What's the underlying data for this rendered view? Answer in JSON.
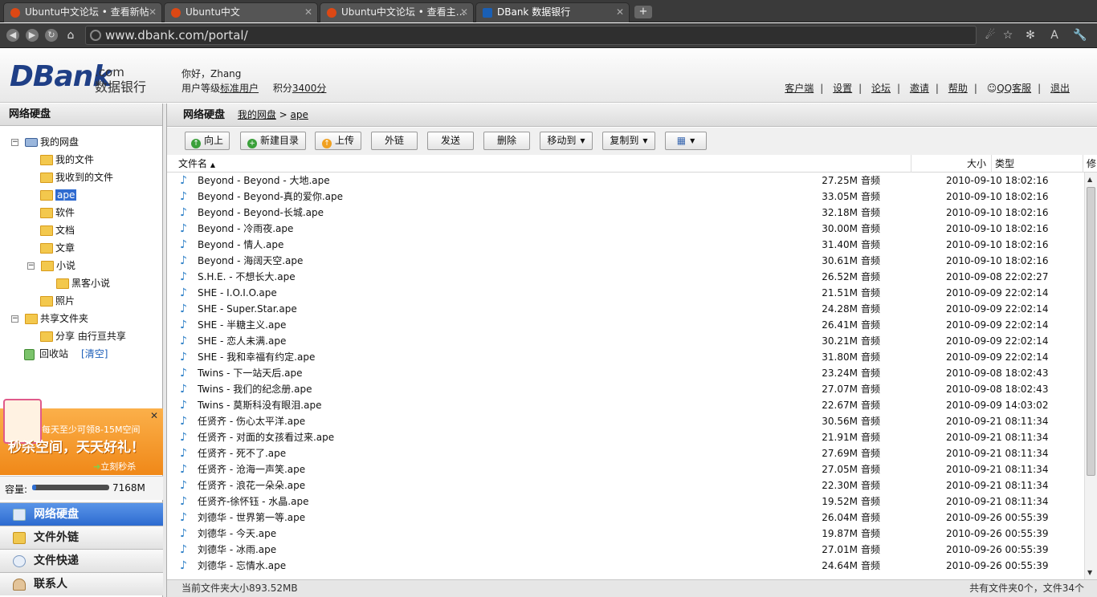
{
  "browser": {
    "tabs": [
      {
        "title": "Ubuntu中文论坛 • 查看新帖",
        "active": false
      },
      {
        "title": "Ubuntu中文",
        "active": false
      },
      {
        "title": "Ubuntu中文论坛 • 查看主…",
        "active": false
      },
      {
        "title": "DBank 数据银行",
        "active": true
      }
    ],
    "new_tab": "+",
    "url": "www.dbank.com/portal/"
  },
  "header": {
    "logo_main": "DBank",
    "logo_com": ".com",
    "logo_cn": "数据银行",
    "greeting": "你好，Zhang",
    "level_label": "用户等级",
    "level_value": "标准用户",
    "points_label": "积分",
    "points_value": "3400分",
    "links": [
      "客户端",
      "设置",
      "论坛",
      "邀请",
      "帮助",
      "QQ客服",
      "退出"
    ]
  },
  "sidebar": {
    "title": "网络硬盘",
    "tree": {
      "my_disk": "我的网盘",
      "my_files": "我的文件",
      "received": "我收到的文件",
      "ape": "ape",
      "software": "软件",
      "docs": "文档",
      "articles": "文章",
      "novels": "小说",
      "hacker_novels": "黑客小说",
      "photos": "照片",
      "shared": "共享文件夹",
      "share_item": "分享 由行亘共享",
      "recycle": "回收站",
      "clear": "[清空]"
    },
    "promo": {
      "line1": "每天至少可领8-15M空间",
      "line2": "秒杀空间，天天好礼！",
      "line3": "立刻秒杀",
      "close": "✕"
    },
    "capacity": {
      "label": "容量:",
      "value": "7168M",
      "used_fraction": 0.05
    },
    "nav": [
      "网络硬盘",
      "文件外链",
      "文件快递",
      "联系人"
    ]
  },
  "main": {
    "breadcrumb_title": "网络硬盘",
    "breadcrumb_root": "我的网盘",
    "breadcrumb_sep": " > ",
    "breadcrumb_current": "ape",
    "toolbar": {
      "up": "向上",
      "new_dir": "新建目录",
      "upload": "上传",
      "link": "外链",
      "send": "发送",
      "delete": "删除",
      "move": "移动到",
      "copy": "复制到"
    },
    "columns": {
      "name": "文件名",
      "sort_arrow": "▲",
      "size": "大小",
      "type": "类型",
      "modified": "修"
    },
    "files": [
      {
        "name": "Beyond - Beyond - 大地.ape",
        "size": "27.25M",
        "type": "音频",
        "date": "2010-09-10 18:02:16"
      },
      {
        "name": "Beyond - Beyond-真的爱你.ape",
        "size": "33.05M",
        "type": "音频",
        "date": "2010-09-10 18:02:16"
      },
      {
        "name": "Beyond - Beyond-长城.ape",
        "size": "32.18M",
        "type": "音频",
        "date": "2010-09-10 18:02:16"
      },
      {
        "name": "Beyond - 冷雨夜.ape",
        "size": "30.00M",
        "type": "音频",
        "date": "2010-09-10 18:02:16"
      },
      {
        "name": "Beyond - 情人.ape",
        "size": "31.40M",
        "type": "音频",
        "date": "2010-09-10 18:02:16"
      },
      {
        "name": "Beyond - 海阔天空.ape",
        "size": "30.61M",
        "type": "音频",
        "date": "2010-09-10 18:02:16"
      },
      {
        "name": "S.H.E. - 不想长大.ape",
        "size": "26.52M",
        "type": "音频",
        "date": "2010-09-08 22:02:27"
      },
      {
        "name": "SHE - I.O.I.O.ape",
        "size": "21.51M",
        "type": "音频",
        "date": "2010-09-09 22:02:14"
      },
      {
        "name": "SHE - Super.Star.ape",
        "size": "24.28M",
        "type": "音频",
        "date": "2010-09-09 22:02:14"
      },
      {
        "name": "SHE - 半糖主义.ape",
        "size": "26.41M",
        "type": "音频",
        "date": "2010-09-09 22:02:14"
      },
      {
        "name": "SHE - 恋人未满.ape",
        "size": "30.21M",
        "type": "音频",
        "date": "2010-09-09 22:02:14"
      },
      {
        "name": "SHE - 我和幸福有约定.ape",
        "size": "31.80M",
        "type": "音频",
        "date": "2010-09-09 22:02:14"
      },
      {
        "name": "Twins - 下一站天后.ape",
        "size": "23.24M",
        "type": "音频",
        "date": "2010-09-08 18:02:43"
      },
      {
        "name": "Twins - 我们的纪念册.ape",
        "size": "27.07M",
        "type": "音频",
        "date": "2010-09-08 18:02:43"
      },
      {
        "name": "Twins - 莫斯科没有眼泪.ape",
        "size": "22.67M",
        "type": "音频",
        "date": "2010-09-09 14:03:02"
      },
      {
        "name": "任贤齐 - 伤心太平洋.ape",
        "size": "30.56M",
        "type": "音频",
        "date": "2010-09-21 08:11:34"
      },
      {
        "name": "任贤齐 - 对面的女孩看过来.ape",
        "size": "21.91M",
        "type": "音频",
        "date": "2010-09-21 08:11:34"
      },
      {
        "name": "任贤齐 - 死不了.ape",
        "size": "27.69M",
        "type": "音频",
        "date": "2010-09-21 08:11:34"
      },
      {
        "name": "任贤齐 - 沧海一声笑.ape",
        "size": "27.05M",
        "type": "音频",
        "date": "2010-09-21 08:11:34"
      },
      {
        "name": "任贤齐 - 浪花一朵朵.ape",
        "size": "22.30M",
        "type": "音频",
        "date": "2010-09-21 08:11:34"
      },
      {
        "name": "任贤齐-徐怀钰 - 水晶.ape",
        "size": "19.52M",
        "type": "音频",
        "date": "2010-09-21 08:11:34"
      },
      {
        "name": "刘德华 - 世界第一等.ape",
        "size": "26.04M",
        "type": "音频",
        "date": "2010-09-26 00:55:39"
      },
      {
        "name": "刘德华 - 今天.ape",
        "size": "19.87M",
        "type": "音频",
        "date": "2010-09-26 00:55:39"
      },
      {
        "name": "刘德华 - 冰雨.ape",
        "size": "27.01M",
        "type": "音频",
        "date": "2010-09-26 00:55:39"
      },
      {
        "name": "刘德华 - 忘情水.ape",
        "size": "24.64M",
        "type": "音频",
        "date": "2010-09-26 00:55:39"
      }
    ],
    "status_left": "当前文件夹大小893.52MB",
    "status_right": "共有文件夹0个，文件34个"
  }
}
